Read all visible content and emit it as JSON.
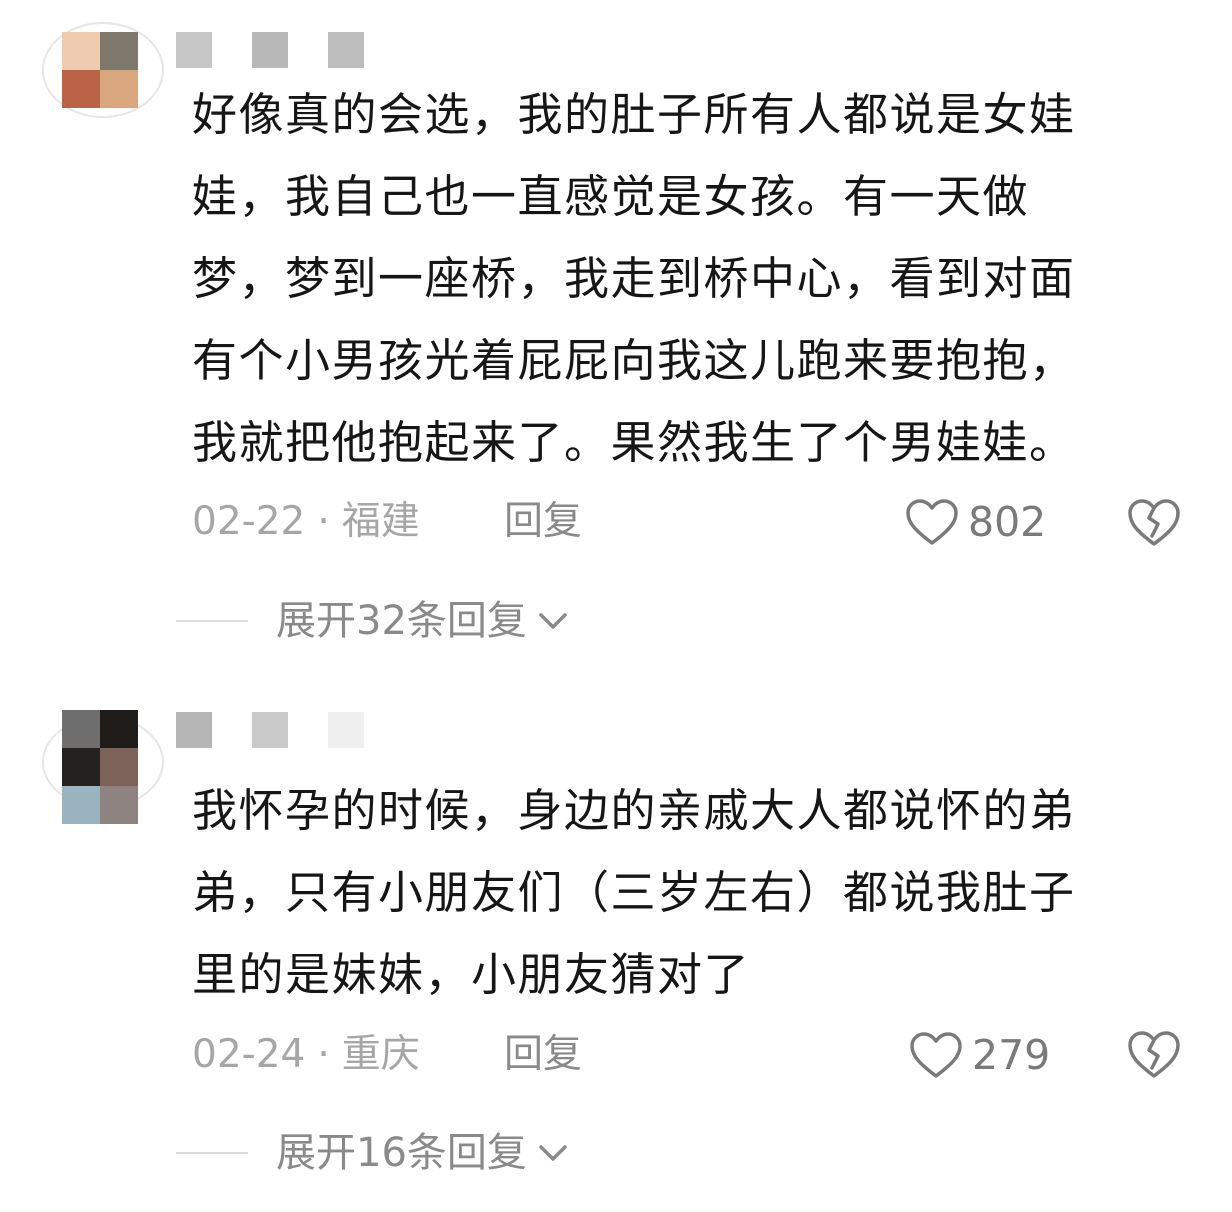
{
  "comments": [
    {
      "text": "好像真的会选，我的肚子所有人都说是女娃\n娃，我自己也一直感觉是女孩。有一天做\n梦，梦到一座桥，我走到桥中心，看到对面\n有个小男孩光着屁屁向我这儿跑来要抱抱，\n我就把他抱起来了。果然我生了个男娃娃。",
      "date": "02-22",
      "separator": "·",
      "location": "福建",
      "reply_label": "回复",
      "likes": "802",
      "expand_label": "展开32条回复",
      "avatar_colors": [
        "#efcbb0",
        "#7e786a",
        "#bb6346",
        "#d9a77e"
      ],
      "name_colors": [
        "#c6c6c6",
        "#b8b8b8",
        "#bdbdbd"
      ],
      "icons": {
        "like": "heart-outline-icon",
        "dislike": "broken-heart-icon",
        "expand": "chevron-down-icon"
      }
    },
    {
      "text": "我怀孕的时候，身边的亲戚大人都说怀的弟\n弟，只有小朋友们（三岁左右）都说我肚子\n里的是妹妹，小朋友猜对了",
      "date": "02-24",
      "separator": "·",
      "location": "重庆",
      "reply_label": "回复",
      "likes": "279",
      "expand_label": "展开16条回复",
      "avatar_colors": [
        "#6e6e6e",
        "#1f1c1a",
        "#242220",
        "#7c6259",
        "#9bb3bf",
        "#8e8380"
      ],
      "name_colors": [
        "#b6b6b6",
        "#c9c9c9",
        "#efefef"
      ],
      "icons": {
        "like": "heart-outline-icon",
        "dislike": "broken-heart-icon",
        "expand": "chevron-down-icon"
      }
    }
  ]
}
